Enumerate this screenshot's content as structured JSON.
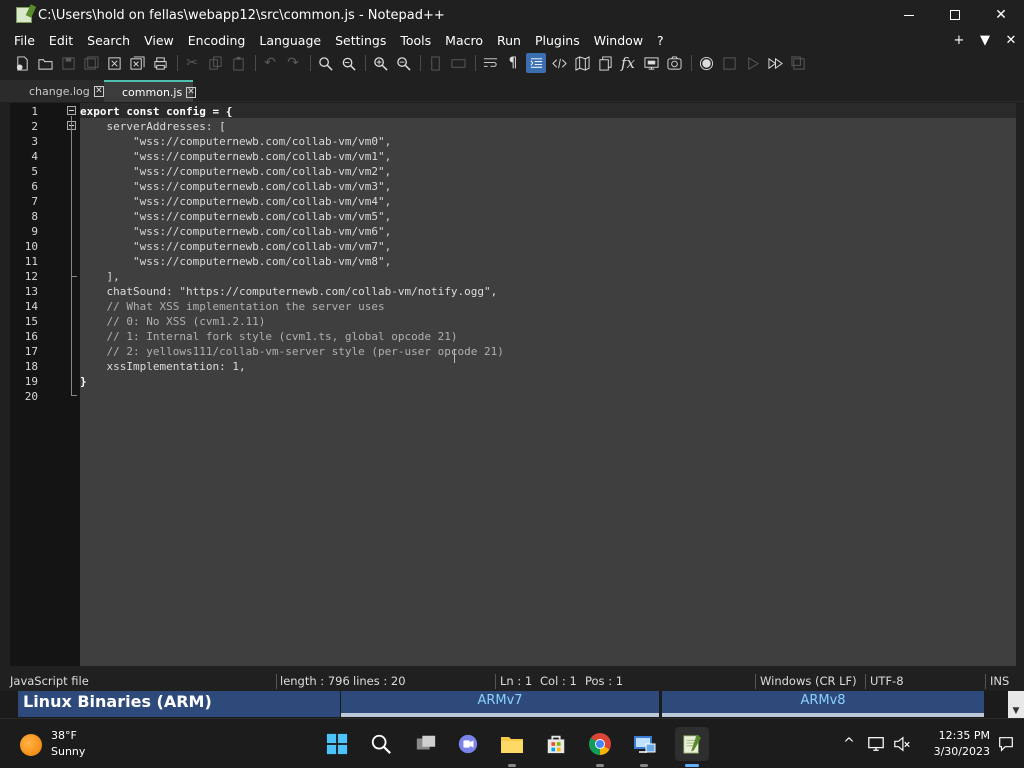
{
  "window": {
    "title": "C:\\Users\\hold on fellas\\webapp12\\src\\common.js - Notepad++",
    "controls": [
      "minimize",
      "maximize",
      "close"
    ]
  },
  "menu": {
    "items": [
      "File",
      "Edit",
      "Search",
      "View",
      "Encoding",
      "Language",
      "Settings",
      "Tools",
      "Macro",
      "Run",
      "Plugins",
      "Window",
      "?"
    ],
    "right": [
      "+",
      "▼",
      "✕"
    ]
  },
  "toolbar": {
    "icons": [
      "new-file",
      "open-file",
      "save",
      "save-all",
      "close",
      "close-all",
      "print",
      "cut",
      "copy",
      "paste",
      "undo",
      "redo",
      "find",
      "replace",
      "zoom-in",
      "zoom-out",
      "sync-vertical",
      "sync-horizontal",
      "word-wrap",
      "show-all-chars",
      "indent-guide",
      "xml-tag",
      "document-map",
      "doc-list",
      "function-list",
      "folder-workspace",
      "monitoring",
      "record-macro",
      "stop-record",
      "play-macro",
      "run-macro-multiple",
      "save-macro"
    ]
  },
  "tabs": [
    {
      "label": "change.log",
      "active": false
    },
    {
      "label": "common.js",
      "active": true
    }
  ],
  "editor": {
    "lines": [
      "export const config = {",
      "    serverAddresses: [",
      "        \"wss://computernewb.com/collab-vm/vm0\",",
      "        \"wss://computernewb.com/collab-vm/vm1\",",
      "        \"wss://computernewb.com/collab-vm/vm2\",",
      "        \"wss://computernewb.com/collab-vm/vm3\",",
      "        \"wss://computernewb.com/collab-vm/vm4\",",
      "        \"wss://computernewb.com/collab-vm/vm5\",",
      "        \"wss://computernewb.com/collab-vm/vm6\",",
      "        \"wss://computernewb.com/collab-vm/vm7\",",
      "        \"wss://computernewb.com/collab-vm/vm8\",",
      "    ],",
      "    chatSound: \"https://computernewb.com/collab-vm/notify.ogg\",",
      "    // What XSS implementation the server uses",
      "    // 0: No XSS (cvm1.2.11)",
      "    // 1: Internal fork style (cvm1.ts, global opcode 21)",
      "    // 2: yellows111/collab-vm-server style (per-user opcode 21)",
      "    xssImplementation: 1,",
      "}",
      ""
    ]
  },
  "statusbar": {
    "file_type": "JavaScript file",
    "length": "length : 796",
    "lines": "lines : 20",
    "ln": "Ln : 1",
    "col": "Col : 1",
    "pos": "Pos : 1",
    "eol": "Windows (CR LF)",
    "encoding": "UTF-8",
    "mode": "INS"
  },
  "background_page": {
    "title": "Linux Binaries (ARM)",
    "cells": [
      "ARMv7",
      "ARMv8"
    ]
  },
  "taskbar": {
    "weather_temp": "38°F",
    "weather_cond": "Sunny",
    "time": "12:35 PM",
    "date": "3/30/2023",
    "apps": [
      "start",
      "search",
      "task-view",
      "teams-chat",
      "file-explorer",
      "store",
      "chrome",
      "remote-desktop",
      "notepad-plus-plus"
    ]
  },
  "colors": {
    "accent_tab": "#4fc0b0",
    "taskbar_active": "#60b0ff",
    "web_header": "#2e4a7a"
  }
}
